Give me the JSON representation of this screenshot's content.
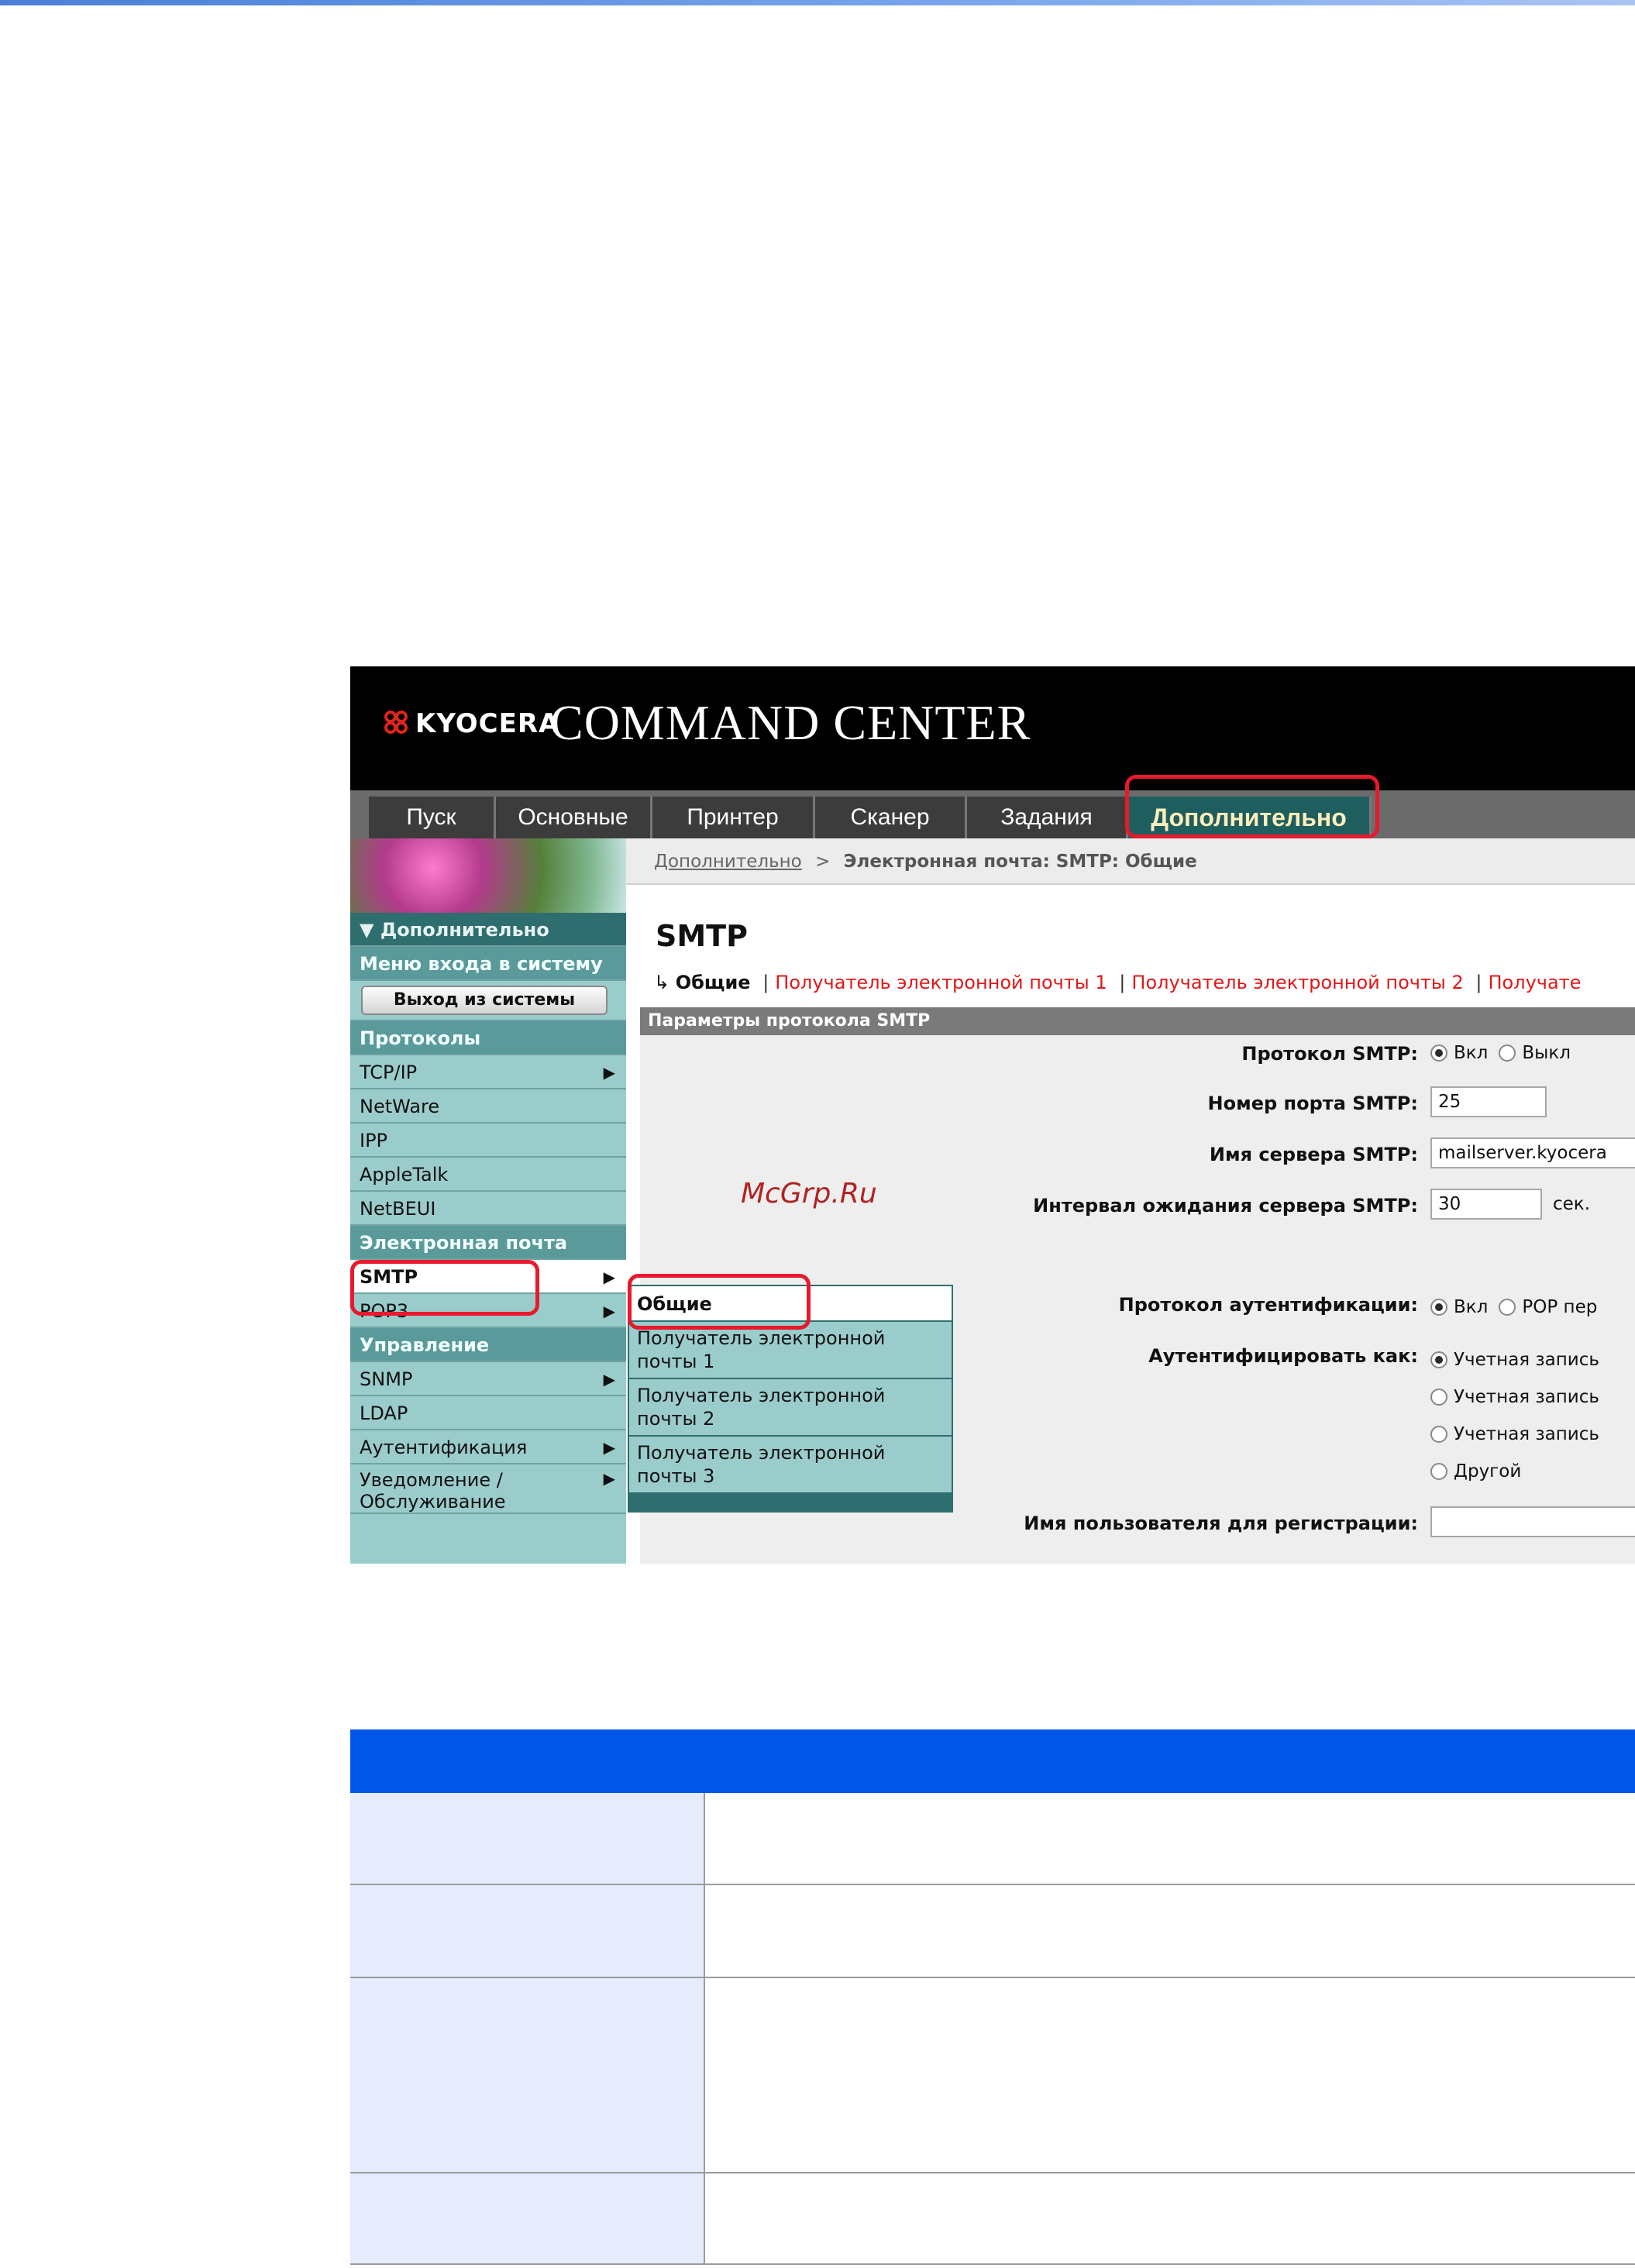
{
  "banner": {
    "logo": "KYOCERA",
    "title": "COMMAND CENTER"
  },
  "tabs": [
    "Пуск",
    "Основные",
    "Принтер",
    "Сканер",
    "Задания",
    "Дополнительно"
  ],
  "sidebar": {
    "header": "▼ Дополнительно",
    "login_menu": "Меню входа в систему",
    "logout_button": "Выход из системы",
    "protocols": "Протоколы",
    "items_protocols": [
      "TCP/IP",
      "NetWare",
      "IPP",
      "AppleTalk",
      "NetBEUI"
    ],
    "email": "Электронная почта",
    "items_email": [
      "SMTP",
      "POP3"
    ],
    "management": "Управление",
    "items_management": [
      "SNMP",
      "LDAP",
      "Аутентификация",
      "Уведомление / Обслуживание"
    ]
  },
  "flyout": [
    "Общие",
    "Получатель электронной почты 1",
    "Получатель электронной почты 2",
    "Получатель электронной почты 3"
  ],
  "breadcrumb": {
    "link": "Дополнительно",
    "sep": ">",
    "current": "Электронная почта: SMTP: Общие"
  },
  "page_title": "SMTP",
  "subnav": {
    "arrow": "↳",
    "current": "Общие",
    "links": [
      "Получатель электронной почты 1",
      "Получатель электронной почты 2",
      "Получате"
    ]
  },
  "section_title": "Параметры протокола SMTP",
  "form": {
    "smtp_protocol_label": "Протокол SMTP:",
    "on": "Вкл",
    "off": "Выкл",
    "port_label": "Номер порта SMTP:",
    "port_value": "25",
    "server_label": "Имя сервера SMTP:",
    "server_value": "mailserver.kyocera",
    "timeout_label": "Интервал ожидания сервера SMTP:",
    "timeout_value": "30",
    "timeout_unit": "сек.",
    "auth_protocol_label": "Протокол аутентификации:",
    "pop_option": "POP пер",
    "auth_as_label": "Аутентифицировать как:",
    "account_option": "Учетная запись",
    "other_option": "Другой",
    "login_user_label": "Имя пользователя для регистрации:"
  },
  "watermark": "McGrp.Ru",
  "colors": {
    "highlight": "#e8192c",
    "table_header": "#0057e7",
    "sidebar": "#9bcccc"
  }
}
